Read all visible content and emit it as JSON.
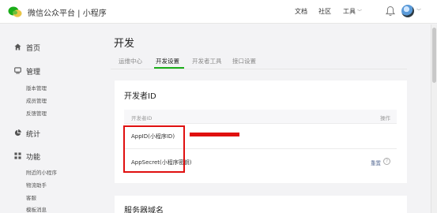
{
  "topbar": {
    "brand": "微信公众平台 | 小程序",
    "nav": {
      "docs": "文档",
      "community": "社区",
      "tools": "工具"
    }
  },
  "sidebar": {
    "home": "首页",
    "manage": {
      "label": "管理",
      "items": [
        "版本管理",
        "成员管理",
        "反馈管理"
      ]
    },
    "stats": "统计",
    "features": {
      "label": "功能",
      "items": [
        "附近的小程序",
        "物流助手",
        "客服",
        "模板消息"
      ]
    }
  },
  "main": {
    "title": "开发",
    "tabs": [
      "运维中心",
      "开发设置",
      "开发者工具",
      "接口设置"
    ],
    "active_tab_index": 1,
    "developer_id": {
      "title": "开发者ID",
      "col_id": "开发者ID",
      "col_action": "操作",
      "rows": [
        {
          "label": "AppID(小程序ID)"
        },
        {
          "label": "AppSecret(小程序密钥)",
          "action": "重置"
        }
      ]
    },
    "server_domain": {
      "title": "服务器域名"
    }
  },
  "colors": {
    "accent": "#1aad19",
    "highlight": "#e01010",
    "link": "#576b95"
  }
}
